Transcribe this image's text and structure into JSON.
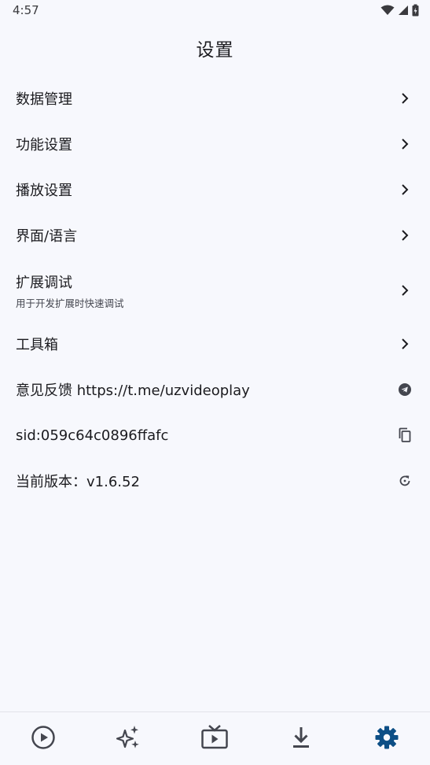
{
  "status_bar": {
    "time": "4:57",
    "icons": [
      "wifi-icon",
      "signal-icon",
      "battery-charging-icon"
    ]
  },
  "header": {
    "title": "设置"
  },
  "settings": {
    "items": [
      {
        "title": "数据管理",
        "trailing_icon": "chevron-right-icon"
      },
      {
        "title": "功能设置",
        "trailing_icon": "chevron-right-icon"
      },
      {
        "title": "播放设置",
        "trailing_icon": "chevron-right-icon"
      },
      {
        "title": "界面/语言",
        "trailing_icon": "chevron-right-icon"
      },
      {
        "title": "扩展调试",
        "subtitle": "用于开发扩展时快速调试",
        "trailing_icon": "chevron-right-icon"
      },
      {
        "title": "工具箱",
        "trailing_icon": "chevron-right-icon"
      },
      {
        "title": "意见反馈 https://t.me/uzvideoplay",
        "trailing_icon": "telegram-icon"
      },
      {
        "title": "sid:059c64c0896ffafc",
        "trailing_icon": "copy-icon"
      },
      {
        "title": "当前版本：v1.6.52",
        "trailing_icon": "refresh-icon"
      }
    ]
  },
  "bottom_nav": {
    "items": [
      {
        "icon": "play-circle-icon",
        "active": false
      },
      {
        "icon": "sparkles-icon",
        "active": false
      },
      {
        "icon": "tv-play-icon",
        "active": false
      },
      {
        "icon": "download-icon",
        "active": false
      },
      {
        "icon": "settings-gear-icon",
        "active": true
      }
    ]
  },
  "colors": {
    "background": "#f7f8fd",
    "text": "#1b1b1f",
    "icon": "#44464f",
    "accent": "#0d4f86"
  }
}
